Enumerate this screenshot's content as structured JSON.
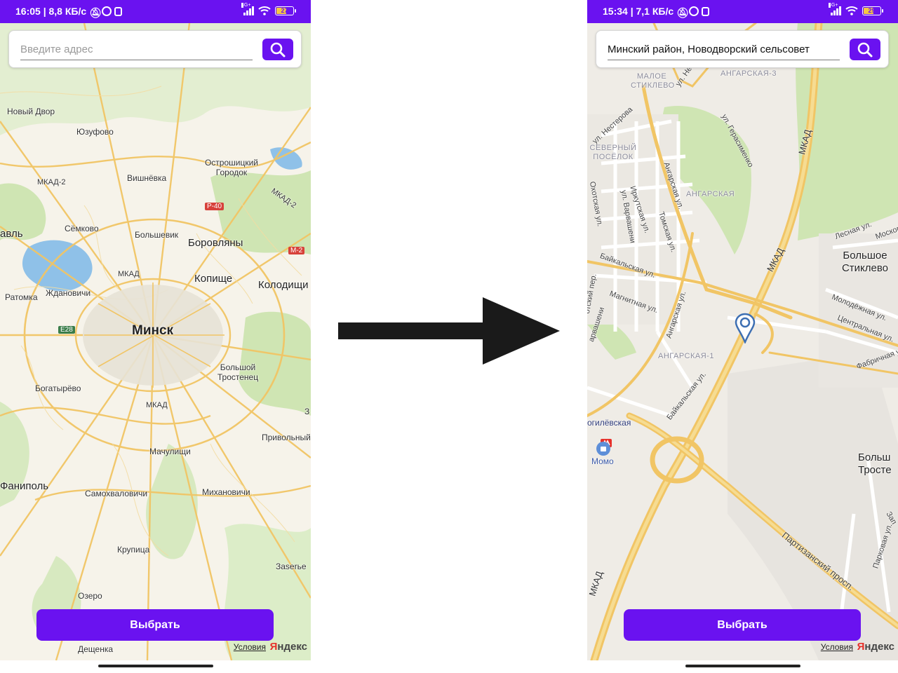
{
  "left_screen": {
    "status": {
      "time_speed": "16:05 | 8,8 КБ/с",
      "network": "4G+",
      "battery": "27"
    },
    "search": {
      "placeholder": "Введите адрес"
    },
    "map_labels": {
      "novy_dvor": "Новый Двор",
      "yuzufovo": "Юзуфово",
      "ostroshitsky": "Острошицкий Городок",
      "mkad2_left": "МКАД-2",
      "vishnevka": "Вишнёвка",
      "mkad2_right": "МКАД-2",
      "p40": "Р-40",
      "semkovo": "Сёмково",
      "bolshevik": "Большевик",
      "borovlyany": "Боровляны",
      "m2": "М-2",
      "avl": "авль",
      "mkad": "МКАД",
      "kopishche": "Копище",
      "kolodishchi": "Колодищи",
      "ratomka": "Ратомка",
      "zhdanovichi": "Ждановичи",
      "e28": "E28",
      "minsk": "Минск",
      "bolshoy_trostenets": "Большой Тростенец",
      "bogatyryovo": "Богатырёво",
      "mkad_south": "МКАД",
      "z": "З",
      "privolny": "Привольный",
      "machulishchi": "Мачулищи",
      "fanipol": "Фаниполь",
      "samokhvalovichi": "Самохваловичи",
      "mikhanovichi": "Михановичи",
      "krupitsa": "Крупица",
      "zazerye": "Заserье",
      "ozero": "Озеро",
      "deshchenka": "Дещенка"
    },
    "select_button": "Выбрать",
    "terms_link": "Условия",
    "brand": "Яндекс"
  },
  "right_screen": {
    "status": {
      "time_speed": "15:34 | 7,1 КБ/с",
      "network": "4G+",
      "battery": "29"
    },
    "search": {
      "value": "Минский район, Новодворский сельсовет"
    },
    "map_labels": {
      "maloe_stiklevo": "МАЛОЕ СТИКЛЕВО",
      "angarskaya3": "АНГАРСКАЯ-3",
      "ul_nesterova": "ул. Нестерова",
      "ul_ne": "ул. Не",
      "ul_gerasimenko": "ул. Герасименко",
      "mkad_n": "МКАД",
      "severny_posyolok": "СЕВЕРНЫЙ ПОСЁЛОК",
      "angarskaya_ul": "Ангарская ул.",
      "irkutskaya": "Иркутская ул.",
      "angarskaya": "АНГАРСКАЯ",
      "okhotskaya": "Охотская ул.",
      "ul_varvasheni": "ул. Варвашени",
      "tomskaya": "Томская ул.",
      "lesnaya": "Лесная ул.",
      "moskovskaya": "Московс",
      "bolshoe_stiklevo": "Большое Стиклево",
      "mkad_mid": "МКАД",
      "baykalskaya": "Байкальская ул.",
      "magnitnaya": "Магнитная ул.",
      "angarskaya_ul2": "Ангарская ул.",
      "molodezhnaya": "Молодёжная ул.",
      "tsentralnaya": "Центральная ул.",
      "okhotsky_per": "отский пер.",
      "varvasheni2": "арвашени",
      "angarskaya1": "АНГАРСКАЯ-1",
      "fabrichnaya": "Фабричная ул.",
      "baykalskaya2": "Байкальская ул.",
      "mogilevskaya": "огилёвская",
      "momo": "Момо",
      "bolsh_troste": "Больш Тросте",
      "partizansky": "Партизанский просп.",
      "parkovaya": "Парковая ул.",
      "zap": "Зап",
      "mkad_s": "МКАД"
    },
    "select_button": "Выбрать",
    "terms_link": "Условия",
    "brand": "Яндекс"
  },
  "colors": {
    "accent": "#6a12f0",
    "map_bg": "#f6f3ea",
    "road": "#f1c565",
    "park": "#cfe5b3",
    "water": "#8fc1e8"
  }
}
